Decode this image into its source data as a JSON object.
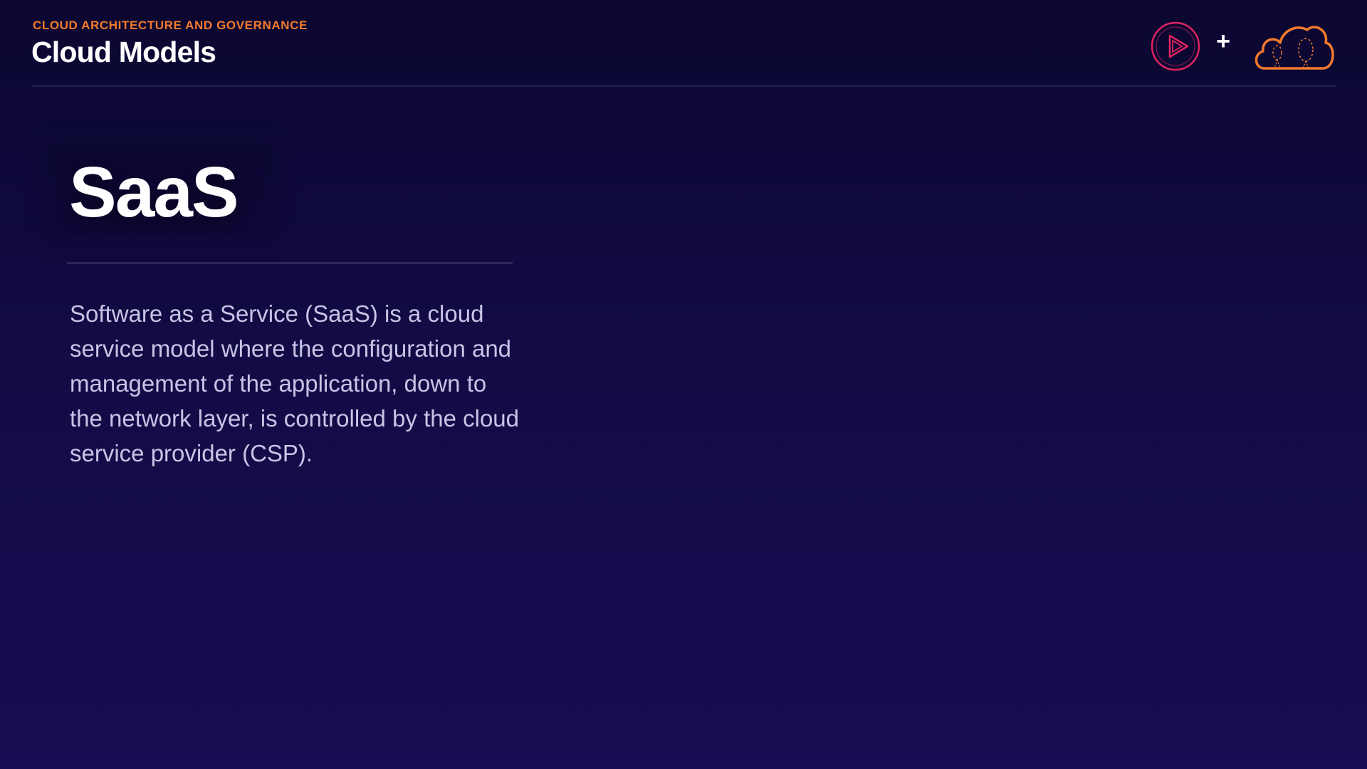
{
  "header": {
    "eyebrow": "CLOUD ARCHITECTURE AND GOVERNANCE",
    "title": "Cloud Models",
    "logos": {
      "first": "play-icon",
      "separator": "+",
      "second": "cloud-icon"
    }
  },
  "slide": {
    "heading": "SaaS",
    "body": "Software as a Service (SaaS) is a cloud service model where the configuration and management of the application, down to the network layer, is controlled by the cloud service provider (CSP)."
  },
  "colors": {
    "accent_orange": "#f47a2c",
    "accent_pink": "#e0245e",
    "background": "#120b45",
    "heading": "#ffffff",
    "body_text": "#c8c4e6"
  }
}
